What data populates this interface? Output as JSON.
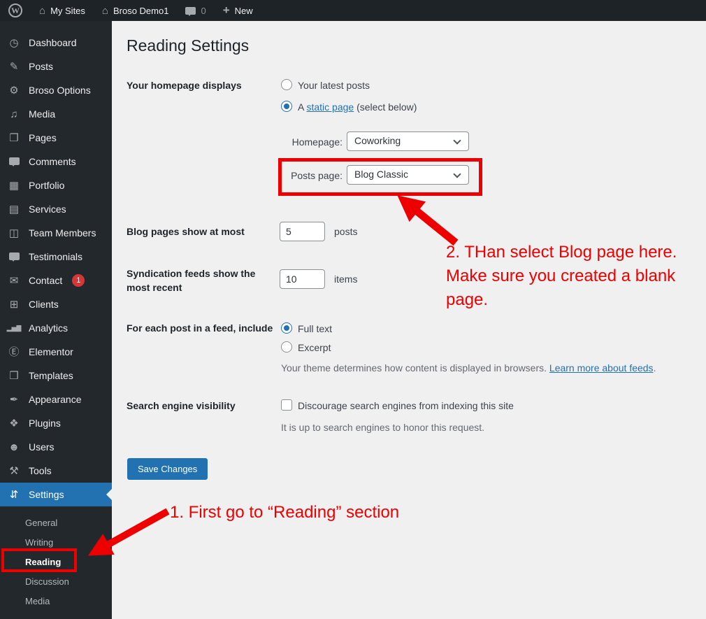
{
  "colors": {
    "accent": "#2271b1",
    "annotation_red": "#ee0000",
    "badge_red": "#d63638",
    "adminbar_bg": "#1d2327",
    "sidebar_bg": "#23282d",
    "content_bg": "#f0f0f1"
  },
  "admin_bar": {
    "wp_logo_letter": "W",
    "my_sites_label": "My Sites",
    "site_name": "Broso Demo1",
    "comment_count": "0",
    "new_label": "New",
    "home_glyph": "⌂"
  },
  "sidebar": {
    "items": [
      {
        "label": "Dashboard",
        "icon": "dashboard-icon",
        "glyph": "◷"
      },
      {
        "label": "Posts",
        "icon": "pushpin-icon",
        "glyph": "✎"
      },
      {
        "label": "Broso Options",
        "icon": "gear-icon",
        "glyph": "⚙"
      },
      {
        "label": "Media",
        "icon": "media-icon",
        "glyph": "♫"
      },
      {
        "label": "Pages",
        "icon": "pages-icon",
        "glyph": "❐"
      },
      {
        "label": "Comments",
        "icon": "comment-bubble-icon",
        "glyph": "",
        "type": "bubble"
      },
      {
        "label": "Portfolio",
        "icon": "portfolio-icon",
        "glyph": "▦"
      },
      {
        "label": "Services",
        "icon": "services-icon",
        "glyph": "▤"
      },
      {
        "label": "Team Members",
        "icon": "id-card-icon",
        "glyph": "◫"
      },
      {
        "label": "Testimonials",
        "icon": "testimonial-bubble-icon",
        "glyph": "",
        "type": "bubble"
      },
      {
        "label": "Contact",
        "icon": "envelope-icon",
        "glyph": "✉",
        "badge": "1"
      },
      {
        "label": "Clients",
        "icon": "grid-icon",
        "glyph": "⊞"
      },
      {
        "label": "Analytics",
        "icon": "bar-chart-icon",
        "glyph": "▂▅▇"
      },
      {
        "label": "Elementor",
        "icon": "elementor-icon",
        "glyph": "Ⓔ"
      },
      {
        "label": "Templates",
        "icon": "folder-icon",
        "glyph": "❒"
      },
      {
        "label": "Appearance",
        "icon": "brush-icon",
        "glyph": "✒"
      },
      {
        "label": "Plugins",
        "icon": "plugin-icon",
        "glyph": "❖"
      },
      {
        "label": "Users",
        "icon": "user-icon",
        "glyph": "☻"
      },
      {
        "label": "Tools",
        "icon": "wrench-icon",
        "glyph": "⚒"
      },
      {
        "label": "Settings",
        "icon": "sliders-icon",
        "glyph": "⇵",
        "active": true
      }
    ],
    "submenu": [
      {
        "label": "General"
      },
      {
        "label": "Writing"
      },
      {
        "label": "Reading",
        "active": true,
        "boxed": true
      },
      {
        "label": "Discussion"
      },
      {
        "label": "Media"
      }
    ]
  },
  "main": {
    "title": "Reading Settings",
    "homepage_displays": {
      "label": "Your homepage displays",
      "option_latest": "Your latest posts",
      "option_latest_selected": false,
      "option_static_prefix": "A ",
      "option_static_link": "static page",
      "option_static_suffix": " (select below)",
      "option_static_selected": true
    },
    "homepage_select": {
      "label": "Homepage:",
      "value": "Coworking"
    },
    "posts_page_select": {
      "label": "Posts page:",
      "value": "Blog Classic"
    },
    "blog_pages": {
      "label": "Blog pages show at most",
      "value": "5",
      "unit": "posts"
    },
    "syndication": {
      "label": "Syndication feeds show the most recent",
      "value": "10",
      "unit": "items"
    },
    "feed_include": {
      "label": "For each post in a feed, include",
      "option_full": "Full text",
      "option_full_selected": true,
      "option_excerpt": "Excerpt",
      "option_excerpt_selected": false,
      "note_prefix": "Your theme determines how content is displayed in browsers. ",
      "note_link": "Learn more about feeds",
      "note_suffix": "."
    },
    "search_visibility": {
      "label": "Search engine visibility",
      "checkbox_label": "Discourage search engines from indexing this site",
      "checkbox_checked": false,
      "note": "It is up to search engines to honor this request."
    },
    "save_button": "Save Changes"
  },
  "annotations": {
    "step1_text": "1. First go to “Reading” section",
    "step2": {
      "lines": [
        "2. THan select Blog page here.",
        "Make sure you created a blank",
        "page."
      ]
    }
  }
}
